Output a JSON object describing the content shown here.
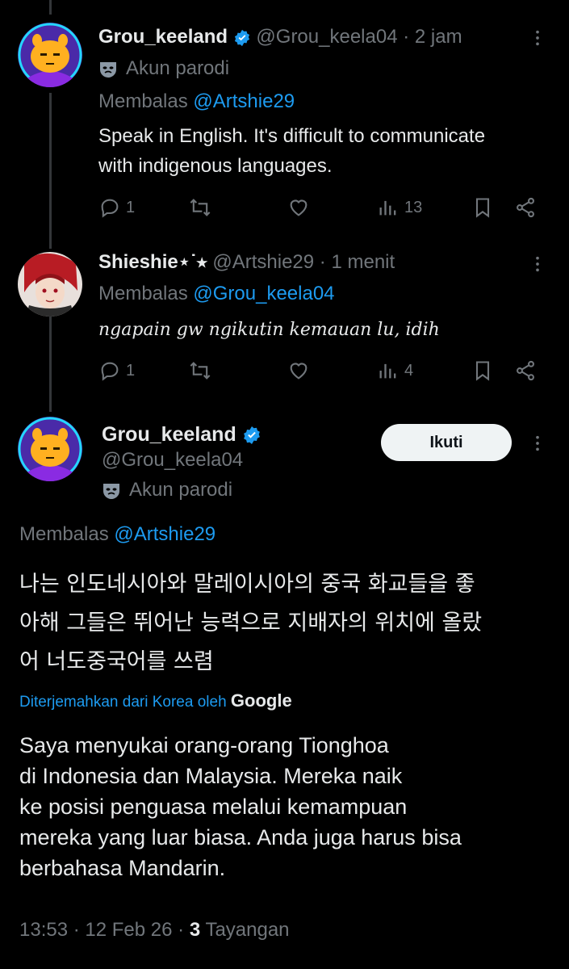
{
  "tweet1": {
    "display_name": "Grou_keeland",
    "handle": "@Grou_keela04",
    "time": "2 jam",
    "parody_label": "Akun parodi",
    "reply_prefix": "Membalas",
    "reply_to": "@Artshie29",
    "text_line1": "Speak in English. It's difficult to communicate",
    "text_line2": "with indigenous languages.",
    "replies": "1",
    "views": "13"
  },
  "tweet2": {
    "display_name": "Shieshie⋆˙⭑",
    "handle": "@Artshie29",
    "time": "1 menit",
    "reply_prefix": "Membalas",
    "reply_to": "@Grou_keela04",
    "text": "ꦔꦒꦥꦆꦤ꧀ꦒꦸꦮ꧀ꦔꦶꦏꦸꦠꦶꦤ꧀ꦏꦺꦩꦸꦮꦤ꧀ꦭꦸ, ꦆꦢꦶꦃ",
    "text_transliteration": "ngapain gw ngikutin kemauan lu, idih",
    "replies": "1",
    "views": "4"
  },
  "main_tweet": {
    "display_name": "Grou_keeland",
    "handle": "@Grou_keela04",
    "parody_label": "Akun parodi",
    "follow_label": "Ikuti",
    "reply_prefix": "Membalas",
    "reply_to": "@Artshie29",
    "korean_line1": "나는 인도네시아와 말레이시아의 중국 화교들을 좋",
    "korean_line2": "아해 그들은 뛰어난 능력으로 지배자의 위치에 올랐",
    "korean_line3": "어 너도중국어를 쓰렴",
    "translated_label": "Diterjemahkan dari Korea oleh",
    "translator_brand": "Google",
    "translation_line1": "Saya menyukai orang-orang Tionghoa",
    "translation_line2": "di Indonesia dan Malaysia. Mereka naik",
    "translation_line3": "ke posisi penguasa melalui kemampuan",
    "translation_line4": "mereka yang luar biasa. Anda juga harus bisa",
    "translation_line5": "berbahasa Mandarin.",
    "time": "13:53",
    "date": "12 Feb 26",
    "view_count": "3",
    "view_label": "Tayangan"
  },
  "colors": {
    "background": "#000000",
    "text": "#e7e9ea",
    "muted": "#71767b",
    "link": "#1d9bf0",
    "verified": "#1d9bf0"
  },
  "icons": [
    "reply-icon",
    "retweet-icon",
    "like-icon",
    "views-icon",
    "bookmark-icon",
    "share-icon",
    "more-icon",
    "verified-icon",
    "parody-mask-icon"
  ]
}
